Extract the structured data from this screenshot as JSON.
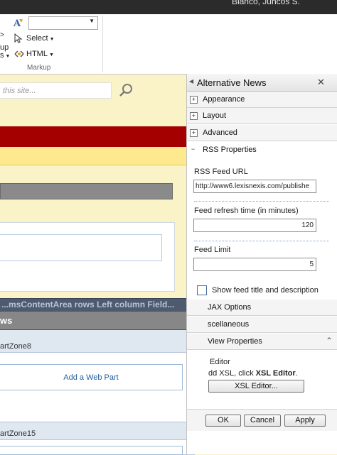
{
  "topbar": {
    "user_name": "Blanco, Juncos S."
  },
  "ribbon": {
    "markup_fragment": "up",
    "s_fragment": "s",
    "select_label": "Select",
    "html_label": "HTML",
    "group_label": "Markup"
  },
  "search": {
    "placeholder": "this site..."
  },
  "overlay": {
    "title": "...msContentArea rows Left column Field...",
    "zone_header": "ws",
    "zone8_label": "artZone8",
    "add_web_part": "Add a Web Part",
    "zone15_label": "artZone15"
  },
  "toolpane": {
    "title": "Alternative News",
    "sections": [
      {
        "label": "Appearance",
        "state": "+"
      },
      {
        "label": "Layout",
        "state": "+"
      },
      {
        "label": "Advanced",
        "state": "+"
      },
      {
        "label": "RSS Properties",
        "state": "−"
      }
    ],
    "rss_url_label": "RSS Feed URL",
    "rss_url_value": "http://www6.lexisnexis.com/publishe",
    "refresh_label": "Feed refresh time (in minutes)",
    "refresh_value": "120",
    "limit_label": "Feed Limit",
    "limit_value": "5",
    "show_title_label": "Show feed title and description",
    "ajax_label": "JAX Options",
    "misc_label": "scellaneous",
    "view_label": "View Properties",
    "editor_label": "Editor",
    "xsl_hint_prefix": "dd XSL, click ",
    "xsl_hint_bold": "XSL Editor",
    "xsl_hint_suffix": ".",
    "xsl_button": "XSL Editor...",
    "ok_button": "OK",
    "cancel_button": "Cancel",
    "apply_button": "Apply"
  }
}
